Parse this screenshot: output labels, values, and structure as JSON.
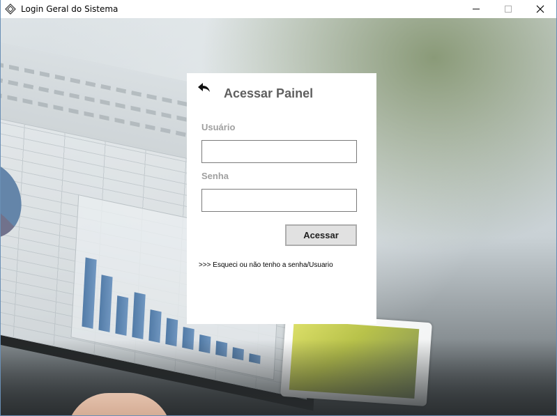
{
  "window": {
    "title": "Login Geral do Sistema",
    "icon": "app-diamond-icon",
    "controls": [
      "minimize-icon",
      "maximize-icon",
      "close-icon"
    ]
  },
  "login": {
    "back_icon": "back-arrow-icon",
    "title": "Acessar Painel",
    "username_label": "Usuário",
    "username_value": "",
    "password_label": "Senha",
    "password_value": "",
    "submit_label": "Acessar",
    "forgot_link": ">>> Esqueci ou não tenho a senha/Usuario"
  },
  "colors": {
    "panel_bg": "#ffffff",
    "title_text": "#5f5f5f",
    "label_text": "#a0a0a0",
    "button_bg": "#e1e1e1",
    "button_border": "#adadad",
    "input_border": "#7a7a7a"
  }
}
